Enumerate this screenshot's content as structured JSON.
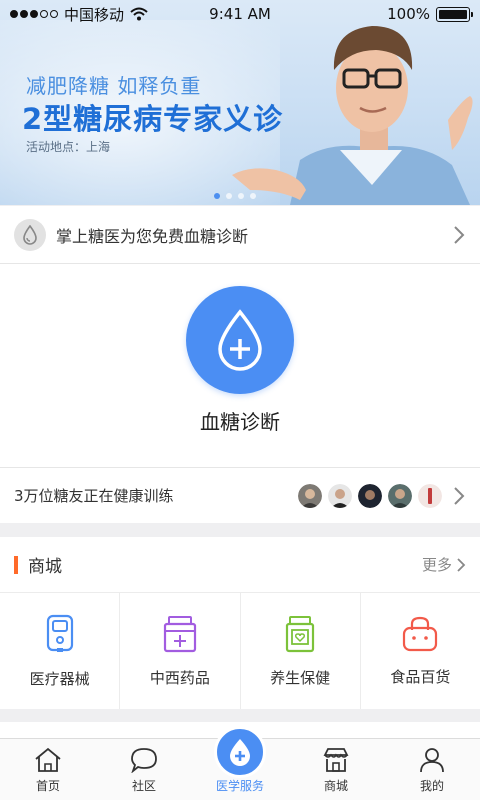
{
  "status_bar": {
    "carrier": "中国移动",
    "time": "9:41 AM",
    "battery": "100%"
  },
  "banner": {
    "subtitle": "减肥降糖   如释负重",
    "title": "2型糖尿病专家义诊",
    "location": "活动地点：上海",
    "page_count": 4,
    "active_page": 1
  },
  "promo": {
    "text": "掌上糖医为您免费血糖诊断"
  },
  "diagnosis": {
    "label": "血糖诊断"
  },
  "friends": {
    "text": "3万位糖友正在健康训练"
  },
  "mall": {
    "title": "商城",
    "more": "更多",
    "items": [
      {
        "label": "医疗器械",
        "icon": "glucometer-icon",
        "color": "#4b8ef3"
      },
      {
        "label": "中西药品",
        "icon": "medicine-jar-icon",
        "color": "#a25ce0"
      },
      {
        "label": "养生保健",
        "icon": "health-jar-icon",
        "color": "#7cc23a"
      },
      {
        "label": "食品百货",
        "icon": "shopping-bag-icon",
        "color": "#f25a4a"
      }
    ]
  },
  "tabbar": {
    "items": [
      {
        "label": "首页",
        "icon": "home-icon"
      },
      {
        "label": "社区",
        "icon": "chat-bubble-icon"
      },
      {
        "label": "医学服务",
        "icon": "medical-drop-icon"
      },
      {
        "label": "商城",
        "icon": "store-icon"
      },
      {
        "label": "我的",
        "icon": "person-icon"
      }
    ],
    "active": "医学服务"
  },
  "colors": {
    "accent": "#4b8ef3",
    "mall_bar": "#ff6a2a"
  }
}
